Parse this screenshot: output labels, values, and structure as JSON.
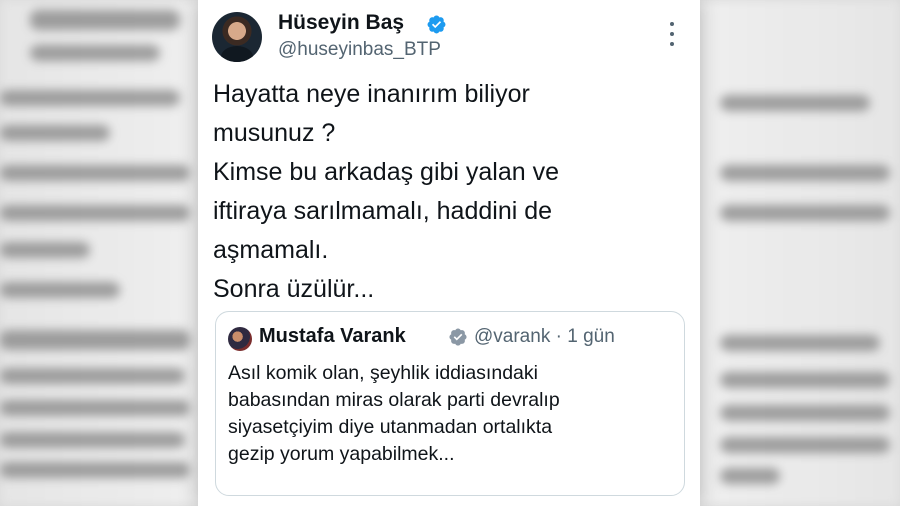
{
  "tweet": {
    "author_name": "Hüseyin Baş",
    "author_handle": "@huseyinbas_BTP",
    "text": "Hayatta neye inanırım biliyor\nmusunuz ?\nKimse bu arkadaş gibi yalan ve\niftiraya sarılmamalı, haddini de\naşmamalı.\nSonra üzülür...",
    "verified_icon": "verified-badge-icon",
    "more_icon": "more-options-icon"
  },
  "quoted_tweet": {
    "author_name": "Mustafa Varank",
    "author_handle": "@varank",
    "separator": "·",
    "time": "1 gün",
    "text": "Asıl komik olan, şeyhlik iddiasındaki\nbabasından miras olarak parti devralıp\nsiyasetçiyim diye utanmadan ortalıkta\ngezip yorum yapabilmek..."
  },
  "colors": {
    "text_primary": "#0f1419",
    "text_secondary": "#536471",
    "verified_blue": "#1d9bf0",
    "border": "#cfd9de"
  }
}
